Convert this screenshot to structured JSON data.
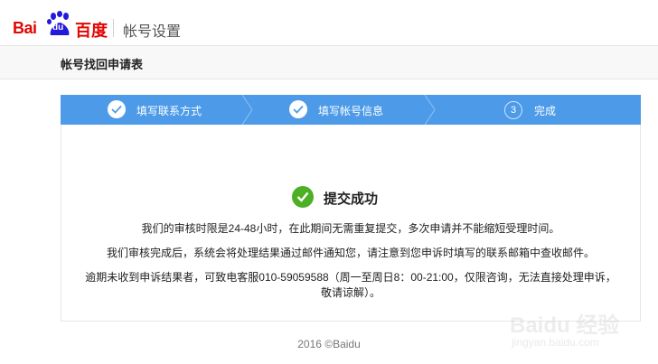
{
  "header": {
    "logo_bai": "Bai",
    "logo_du": "du",
    "logo_cn": "百度",
    "title": "帐号设置"
  },
  "subbar": {
    "form_title": "帐号找回申请表"
  },
  "steps": [
    {
      "label": "填写联系方式",
      "state": "done",
      "icon": "check-icon"
    },
    {
      "label": "填写帐号信息",
      "state": "done",
      "icon": "check-icon"
    },
    {
      "label": "完成",
      "state": "current",
      "number": "3"
    }
  ],
  "result": {
    "title": "提交成功",
    "line1": "我们的审核时限是24-48小时，在此期间无需重复提交，多次申请并不能缩短受理时间。",
    "line2": "我们审核完成后，系统会将处理结果通过邮件通知您，请注意到您申诉时填写的联系邮箱中查收邮件。",
    "line3": "逾期未收到申诉结果者，可致电客服010-59059588（周一至周日8：00-21:00，仅限咨询，无法直接处理申诉，",
    "line3b": "敬请谅解）。"
  },
  "footer": {
    "copyright": "2016 ©Baidu"
  },
  "watermark": {
    "text": "Baidu 经验",
    "url": "jingyan.baidu.com"
  },
  "colors": {
    "brand_red": "#e10601",
    "steps_blue": "#4d9be8",
    "success_green": "#4caf24"
  }
}
